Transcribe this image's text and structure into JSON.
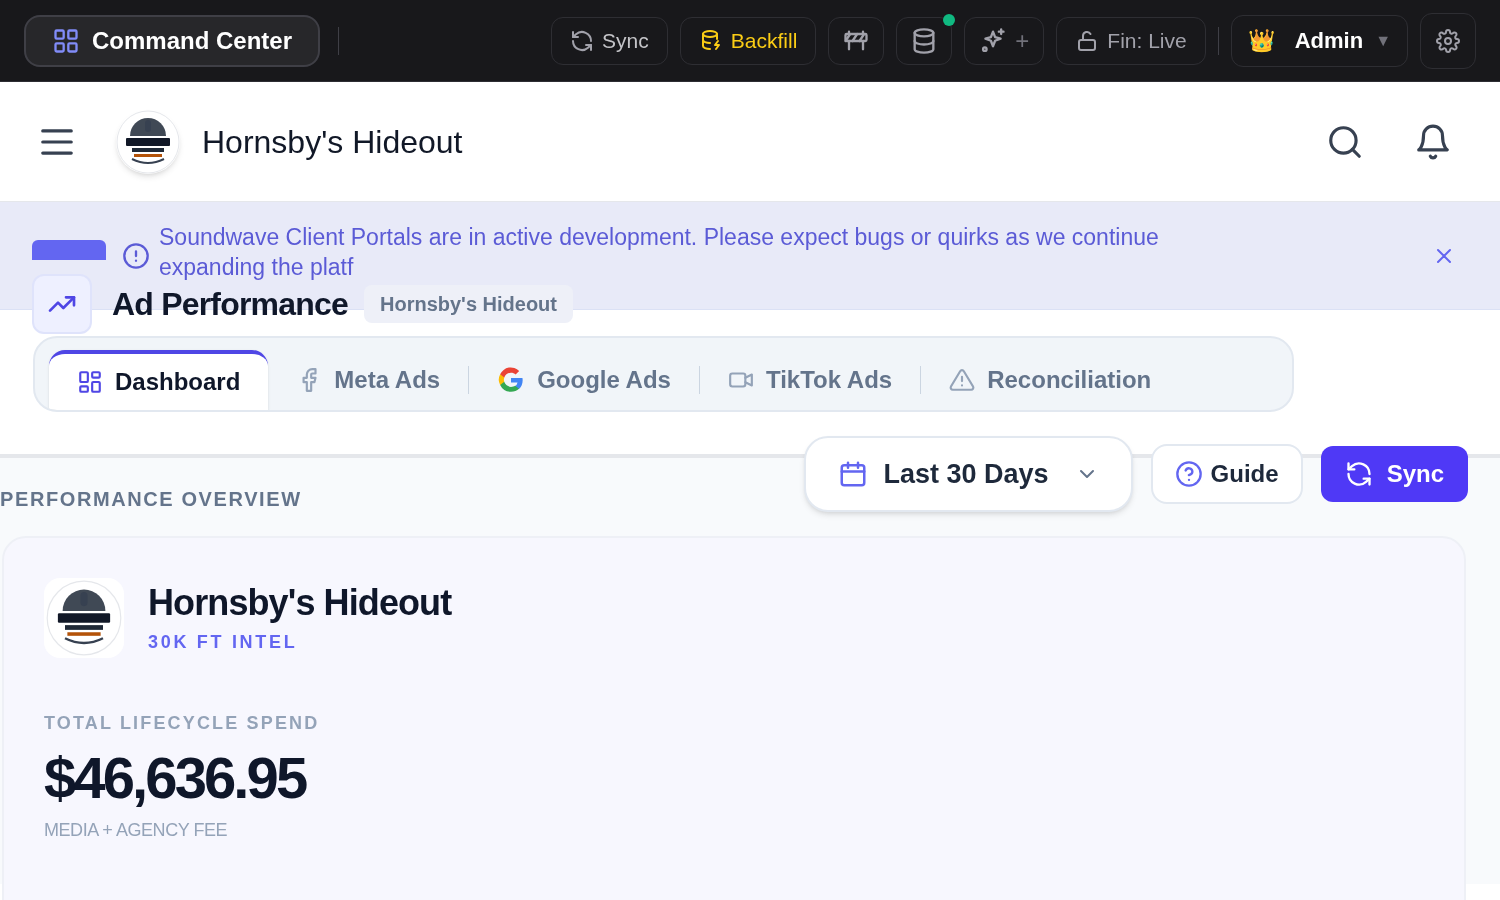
{
  "top_bar": {
    "home_button": "Command Center",
    "buttons": [
      {
        "kind": "sync",
        "label": "Sync"
      },
      {
        "kind": "backfill",
        "label": "Backfill"
      },
      {
        "kind": "barrier"
      },
      {
        "kind": "database",
        "status_dot": true
      },
      {
        "kind": "sparkle",
        "label": "+"
      },
      {
        "kind": "lock",
        "label": "Fin: Live"
      }
    ],
    "user_menu": {
      "emoji": "👑",
      "label": "Admin",
      "caret": "▼"
    }
  },
  "header": {
    "title": "Hornsby's Hideout"
  },
  "banner": {
    "line_1": "Soundwave Client Portals are in active development. Please expect bugs or quirks as we continue",
    "line_2": "expanding the platf"
  },
  "page": {
    "title": "Ad Performance",
    "client_chip": "Hornsby's Hideout"
  },
  "tabs": [
    {
      "kind": "dashboard",
      "label": "Dashboard",
      "selected": true
    },
    {
      "kind": "meta",
      "label": "Meta Ads",
      "selected": false
    },
    {
      "kind": "google",
      "label": "Google Ads",
      "selected": false
    },
    {
      "kind": "tiktok",
      "label": "TikTok Ads",
      "selected": false
    },
    {
      "kind": "reconciliation",
      "label": "Reconciliation",
      "selected": false
    }
  ],
  "controls": {
    "date_range": "Last 30 Days",
    "guide": "Guide",
    "sync": "Sync"
  },
  "section_title": "PERFORMANCE OVERVIEW",
  "overview_card": {
    "client_name": "Hornsby's Hideout",
    "subtitle": "30K FT INTEL",
    "metric_label": "TOTAL LIFECYCLE SPEND",
    "metric_value": "$46,636.95",
    "metric_note": "MEDIA + AGENCY FEE"
  }
}
